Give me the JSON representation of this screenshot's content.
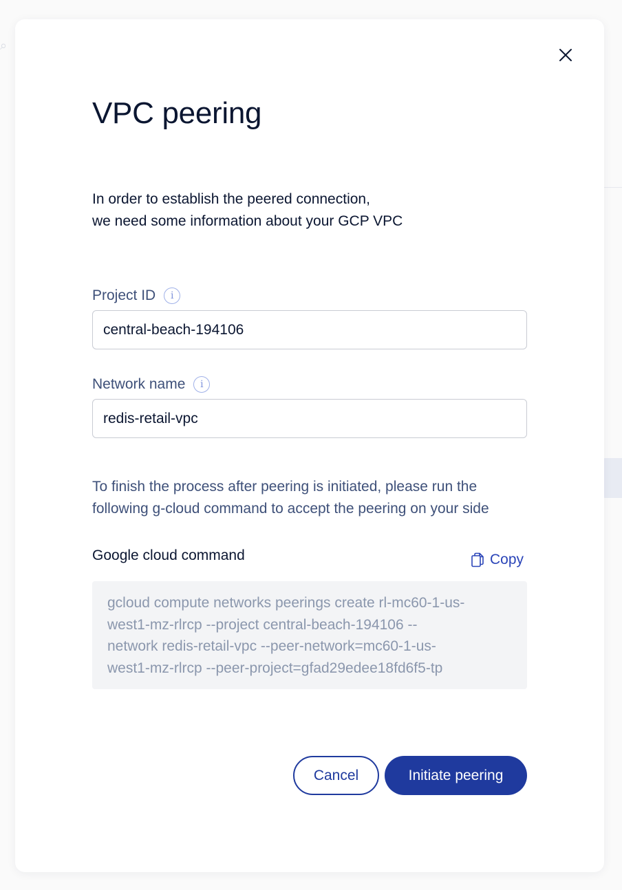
{
  "modal": {
    "title": "VPC peering",
    "intro_lines": [
      "In order to establish the peered connection,",
      "we need some information about your GCP VPC"
    ],
    "project_id": {
      "label": "Project ID",
      "value": "central-beach-194106",
      "info_icon": "info-icon"
    },
    "network_name": {
      "label": "Network name",
      "value": "redis-retail-vpc",
      "info_icon": "info-icon"
    },
    "finish_note_lines": [
      "To finish the process after peering is initiated, please run the",
      "following g-cloud command to accept the peering on your side"
    ],
    "command": {
      "label": "Google cloud command",
      "copy_label": "Copy",
      "copy_icon": "copy-icon",
      "lines": [
        "gcloud compute networks peerings create rl-mc60-1-us-",
        "west1-mz-rlrcp --project central-beach-194106 --",
        "network redis-retail-vpc --peer-network=mc60-1-us-",
        "west1-mz-rlrcp --peer-project=gfad29edee18fd6f5-tp"
      ]
    },
    "buttons": {
      "cancel": "Cancel",
      "initiate": "Initiate peering"
    },
    "close_icon": "close-icon"
  },
  "colors": {
    "primary": "#1f3a9e",
    "heading_text": "#0b1631",
    "label_text": "#3e5079",
    "command_text": "#8b97ad",
    "command_bg": "#f3f4f6"
  }
}
